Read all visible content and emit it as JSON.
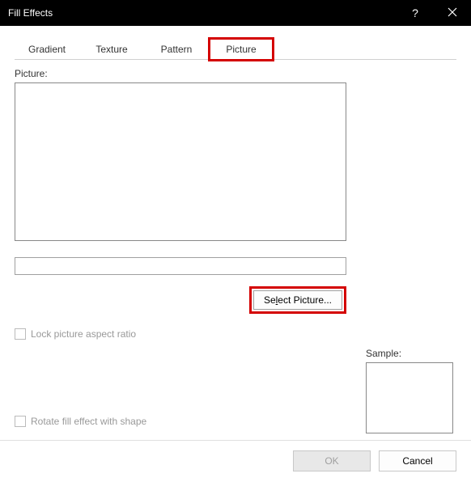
{
  "titlebar": {
    "title": "Fill Effects"
  },
  "tabs": {
    "gradient": "Gradient",
    "texture": "Texture",
    "pattern": "Pattern",
    "picture": "Picture"
  },
  "picture": {
    "label": "Picture:",
    "select_button_prefix": "Se",
    "select_button_underline": "l",
    "select_button_suffix": "ect Picture..."
  },
  "options": {
    "lock_aspect": "Lock picture aspect ratio",
    "rotate_fill": "Rotate fill effect with shape"
  },
  "sample": {
    "label": "Sample:"
  },
  "buttons": {
    "ok": "OK",
    "cancel": "Cancel"
  }
}
